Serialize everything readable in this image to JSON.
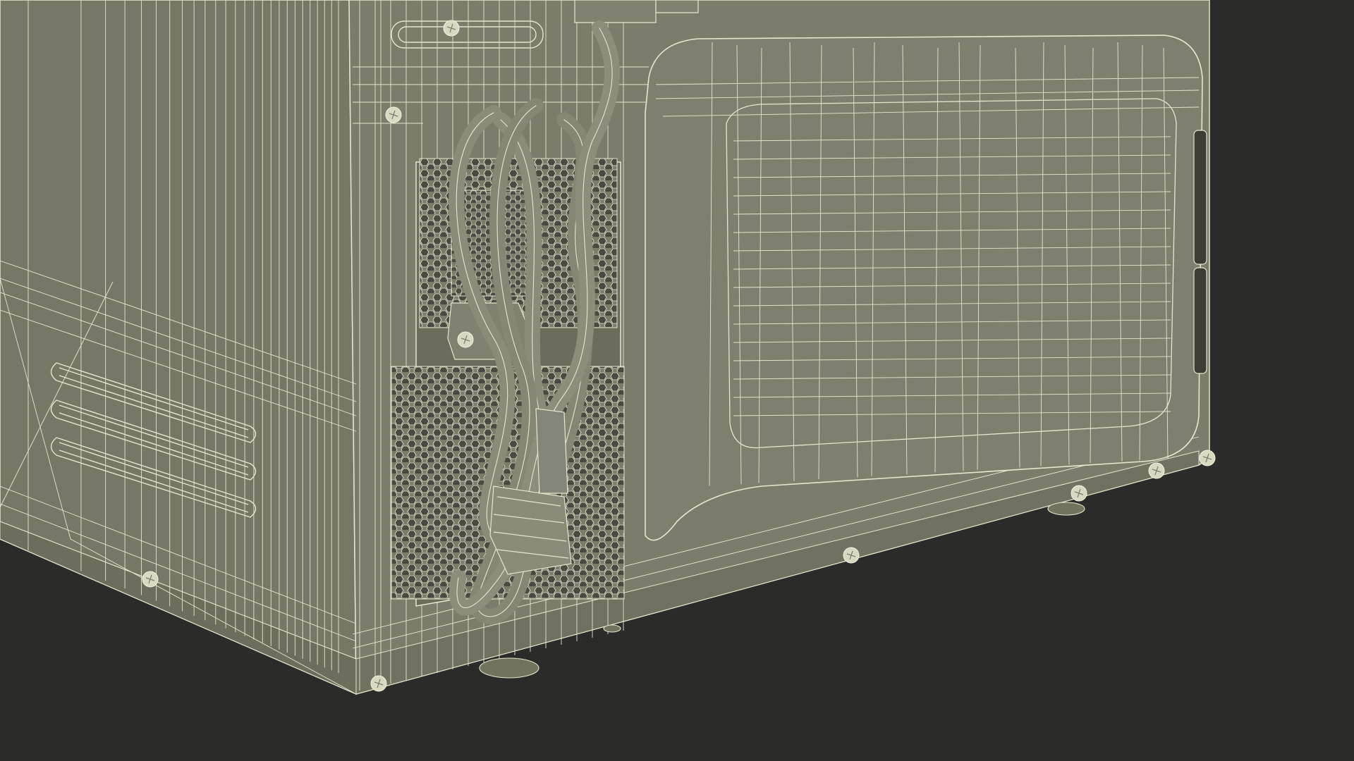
{
  "scene": {
    "subject": "microwave-oven-rear-wireframe",
    "colors": {
      "background": "#2b2b29",
      "surface": "#7b7c6b",
      "surface_dark": "#6f705f",
      "surface_side": "#767766",
      "vent_hole": "#4a4a42",
      "wire": "#e6e6cf",
      "wire_soft": "#d5d6bd"
    },
    "parts": {
      "side_vent_slots": 3,
      "cable_coils": 3,
      "screws": 9
    }
  }
}
